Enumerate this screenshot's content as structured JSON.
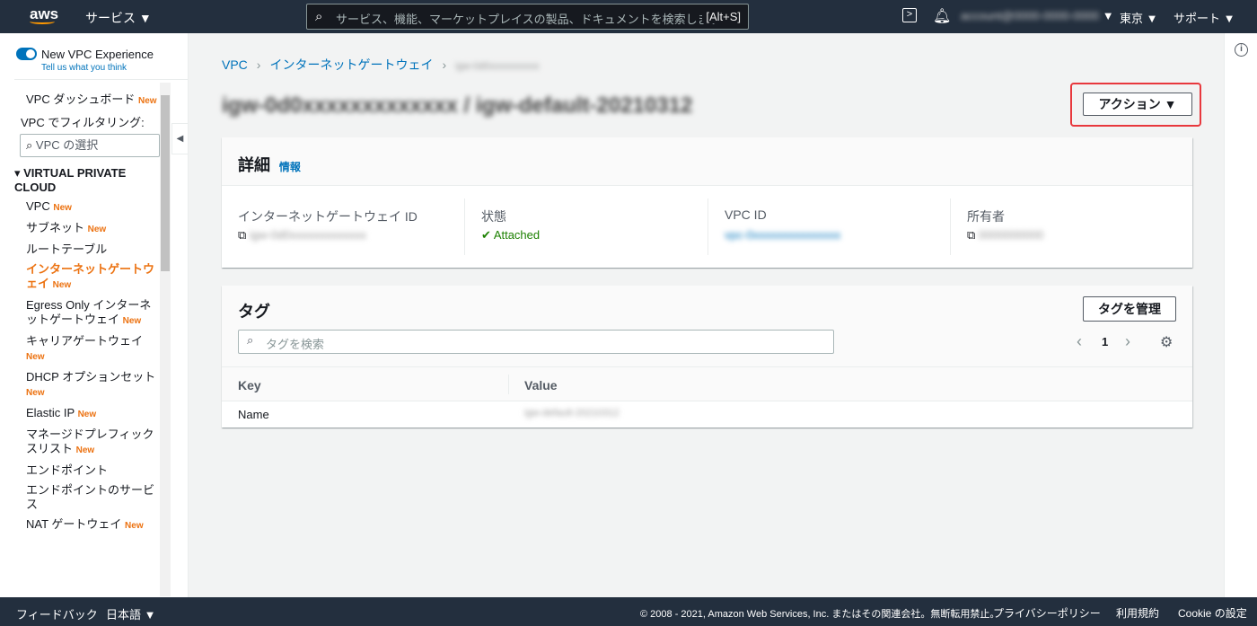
{
  "header": {
    "logo": "aws",
    "services": "サービス ▼",
    "search_placeholder": "サービス、機能、マーケットプレイスの製品、ドキュメントを検索します",
    "search_shortcut": "[Alt+S]",
    "account": "account@0000-0000-0000",
    "region": "東京 ▼",
    "support": "サポート ▼"
  },
  "sidebar": {
    "toggle_label": "New VPC Experience",
    "feedback_link": "Tell us what you think",
    "filter_label": "VPC でフィルタリング:",
    "filter_placeholder": "VPC の選択",
    "section": "VIRTUAL PRIVATE CLOUD",
    "new_badge": "New",
    "items": [
      {
        "label": "VPC ダッシュボード",
        "new": true
      },
      {
        "label": "VPC",
        "new": true
      },
      {
        "label": "サブネット",
        "new": true
      },
      {
        "label": "ルートテーブル",
        "new": false
      },
      {
        "label": "インターネットゲートウェイ",
        "new": true,
        "active": true
      },
      {
        "label": "Egress Only インターネットゲートウェイ",
        "new": true
      },
      {
        "label": "キャリアゲートウェイ",
        "new": true
      },
      {
        "label": "DHCP オプションセット",
        "new": true
      },
      {
        "label": "Elastic IP",
        "new": true
      },
      {
        "label": "マネージドプレフィックスリスト",
        "new": true
      },
      {
        "label": "エンドポイント",
        "new": false
      },
      {
        "label": "エンドポイントのサービス",
        "new": false
      },
      {
        "label": "NAT ゲートウェイ",
        "new": true
      }
    ]
  },
  "breadcrumb": [
    "VPC",
    "インターネットゲートウェイ",
    "igw-0d0xxxxxxxxxx"
  ],
  "page_title": "igw-0d0xxxxxxxxxxxxx / igw-default-20210312",
  "actions_button": "アクション ▼",
  "details": {
    "title": "詳細",
    "info": "情報",
    "fields": [
      {
        "label": "インターネットゲートウェイ ID",
        "value": "igw-0d0xxxxxxxxxxxxx"
      },
      {
        "label": "状態",
        "value": "Attached"
      },
      {
        "label": "VPC ID",
        "value": "vpc-0xxxxxxxxxxxxxxx"
      },
      {
        "label": "所有者",
        "value": "0000000000"
      }
    ]
  },
  "tags": {
    "title": "タグ",
    "manage": "タグを管理",
    "search_placeholder": "タグを検索",
    "page": "1",
    "columns": [
      "Key",
      "Value"
    ],
    "rows": [
      {
        "key": "Name",
        "value": "igw-default-20210312"
      }
    ]
  },
  "footer": {
    "feedback": "フィードバック",
    "language": "日本語 ▼",
    "copyright": "© 2008 - 2021, Amazon Web Services, Inc. またはその関連会社。無断転用禁止。",
    "privacy": "プライバシーポリシー",
    "terms": "利用規約",
    "cookie": "Cookie の設定"
  }
}
